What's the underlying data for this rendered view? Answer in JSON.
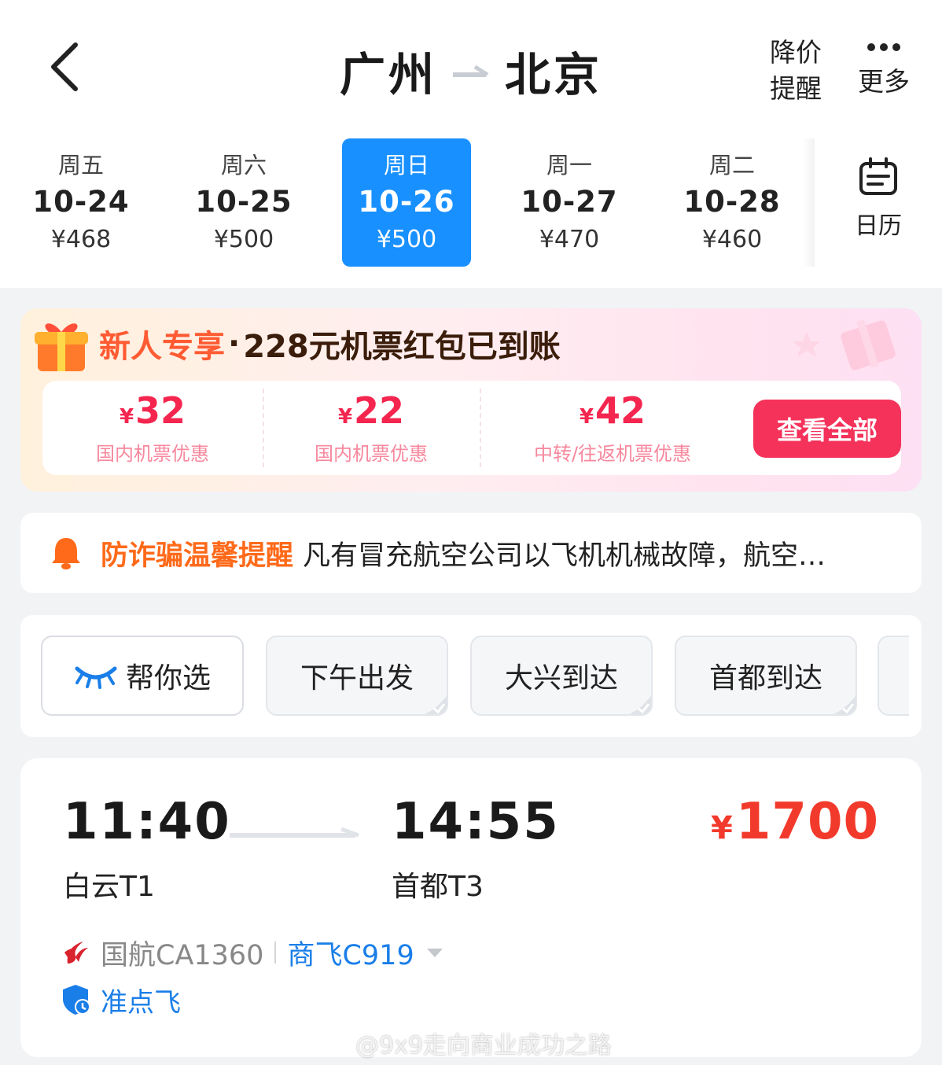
{
  "header": {
    "origin": "广州",
    "destination": "北京",
    "price_alert_line1": "降价",
    "price_alert_line2": "提醒",
    "more_label": "更多"
  },
  "dates": [
    {
      "weekday": "周五",
      "date": "10-24",
      "price": "¥468",
      "selected": false
    },
    {
      "weekday": "周六",
      "date": "10-25",
      "price": "¥500",
      "selected": false
    },
    {
      "weekday": "周日",
      "date": "10-26",
      "price": "¥500",
      "selected": true
    },
    {
      "weekday": "周一",
      "date": "10-27",
      "price": "¥470",
      "selected": false
    },
    {
      "weekday": "周二",
      "date": "10-28",
      "price": "¥460",
      "selected": false
    }
  ],
  "calendar_label": "日历",
  "promo": {
    "title_highlight": "新人专享",
    "separator": "·",
    "title_rest": "228元机票红包已到账",
    "coupons": [
      {
        "currency": "¥",
        "amount": "32",
        "desc": "国内机票优惠"
      },
      {
        "currency": "¥",
        "amount": "22",
        "desc": "国内机票优惠"
      },
      {
        "currency": "¥",
        "amount": "42",
        "desc": "中转/往返机票优惠"
      }
    ],
    "view_all_label": "查看全部"
  },
  "notice": {
    "title": "防诈骗温馨提醒",
    "text": "凡有冒充航空公司以飞机机械故障，航空公司将进行退改签等理由要求转账的均为诈骗"
  },
  "filters": [
    {
      "label": "帮你选"
    },
    {
      "label": "下午出发"
    },
    {
      "label": "大兴到达"
    },
    {
      "label": "首都到达"
    }
  ],
  "flight": {
    "dep_time": "11:40",
    "arr_time": "14:55",
    "dep_airport": "白云T1",
    "arr_airport": "首都T3",
    "currency": "¥",
    "price": "1700",
    "flight_no": "国航CA1360",
    "aircraft": "商飞C919",
    "ontime_label": "准点飞"
  },
  "watermark": "@9x9走向商业成功之路",
  "colors": {
    "accent_blue": "#1890ff",
    "price_red": "#f23a2c",
    "promo_pink": "#f4325a",
    "notice_orange": "#ff6a1a",
    "link_blue": "#1a7ee8"
  }
}
